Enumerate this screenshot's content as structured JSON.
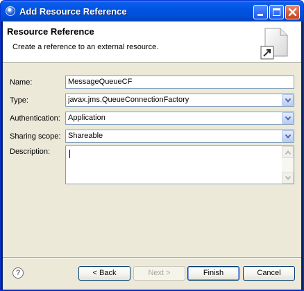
{
  "window": {
    "title": "Add Resource Reference"
  },
  "banner": {
    "title": "Resource Reference",
    "description": "Create a reference to an external resource."
  },
  "form": {
    "name_label": "Name:",
    "name_value": "MessageQueueCF",
    "type_label": "Type:",
    "type_value": "javax.jms.QueueConnectionFactory",
    "auth_label": "Authentication:",
    "auth_value": "Application",
    "sharing_label": "Sharing scope:",
    "sharing_value": "Shareable",
    "description_label": "Description:",
    "description_value": ""
  },
  "buttons": {
    "help": "?",
    "back": "< Back",
    "next": "Next >",
    "finish": "Finish",
    "cancel": "Cancel"
  },
  "icons": {
    "app": "eclipse-app-icon",
    "wizard": "new-resource-wizard-icon",
    "help": "help-icon"
  },
  "colors": {
    "titlebar": "#0054e3",
    "dialog_bg": "#ece9d8",
    "field_border": "#7f9db9"
  }
}
